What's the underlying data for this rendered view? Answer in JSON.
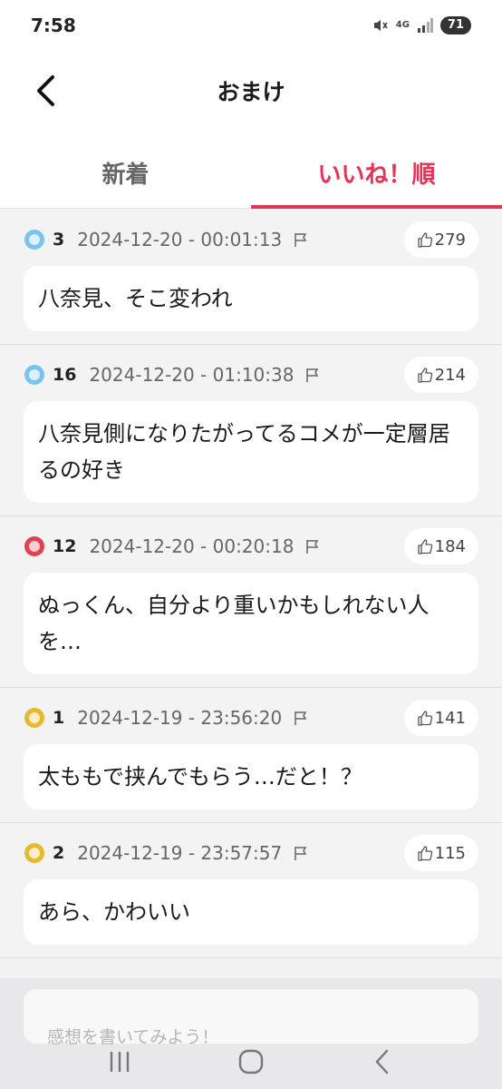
{
  "status_bar": {
    "time": "7:58",
    "network": "4G",
    "battery": "71"
  },
  "header": {
    "title": "おまけ"
  },
  "tabs": [
    {
      "label": "新着",
      "active": false
    },
    {
      "label": "いいね！順",
      "active": true
    }
  ],
  "comments": [
    {
      "rank": "3",
      "date": "2024-12-20 - 00:01:13",
      "likes": "279",
      "text": "八奈見、そこ変われ",
      "badge_color": "#7ac3ef"
    },
    {
      "rank": "16",
      "date": "2024-12-20 - 01:10:38",
      "likes": "214",
      "text": "八奈見側になりたがってるコメが一定層居るの好き",
      "badge_color": "#7ac3ef"
    },
    {
      "rank": "12",
      "date": "2024-12-20 - 00:20:18",
      "likes": "184",
      "text": "ぬっくん、自分より重いかもしれない人を…",
      "badge_color": "#e5404f"
    },
    {
      "rank": "1",
      "date": "2024-12-19 - 23:56:20",
      "likes": "141",
      "text": "太ももで挟んでもらう…だと！？",
      "badge_color": "#e7b92c"
    },
    {
      "rank": "2",
      "date": "2024-12-19 - 23:57:57",
      "likes": "115",
      "text": "あら、かわいい",
      "badge_color": "#e7b92c"
    }
  ],
  "input": {
    "placeholder": "感想を書いてみよう！"
  },
  "colors": {
    "accent": "#e63456",
    "background": "#f3f3f4"
  }
}
